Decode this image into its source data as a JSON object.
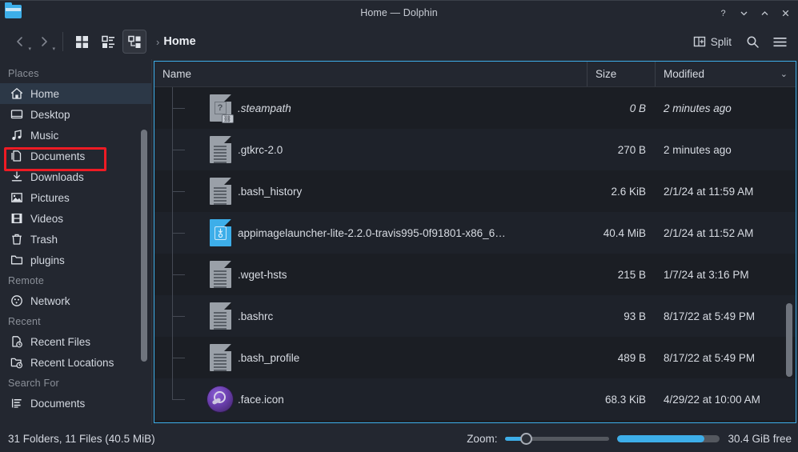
{
  "window": {
    "title": "Home — Dolphin",
    "icon": "folder-icon",
    "buttons": [
      {
        "name": "help-button",
        "glyph": "?"
      },
      {
        "name": "minimize-button",
        "glyph": "chevron-down"
      },
      {
        "name": "maximize-button",
        "glyph": "chevron-up"
      },
      {
        "name": "close-button",
        "glyph": "close"
      }
    ]
  },
  "toolbar": {
    "back_label": "back-icon",
    "forward_label": "forward-icon",
    "view_modes": [
      {
        "name": "view-mode-icons",
        "label": "Icons",
        "active": false
      },
      {
        "name": "view-mode-compact",
        "label": "Compact",
        "active": false
      },
      {
        "name": "view-mode-details",
        "label": "Details",
        "active": true
      }
    ],
    "breadcrumb_arrow": "›",
    "breadcrumb": "Home",
    "split_label": "Split",
    "search_label": "search-icon",
    "menu_label": "hamburger-menu-icon"
  },
  "sidebar": {
    "sections": [
      {
        "header": "Places",
        "items": [
          {
            "label": "Home",
            "icon": "home-icon",
            "selected": true
          },
          {
            "label": "Desktop",
            "icon": "desktop-icon",
            "selected": false
          },
          {
            "label": "Music",
            "icon": "music-icon",
            "selected": false
          },
          {
            "label": "Documents",
            "icon": "documents-icon",
            "selected": false
          },
          {
            "label": "Downloads",
            "icon": "downloads-icon",
            "selected": false
          },
          {
            "label": "Pictures",
            "icon": "pictures-icon",
            "selected": false
          },
          {
            "label": "Videos",
            "icon": "videos-icon",
            "selected": false
          },
          {
            "label": "Trash",
            "icon": "trash-icon",
            "selected": false
          },
          {
            "label": "plugins",
            "icon": "folder-icon",
            "selected": false
          }
        ]
      },
      {
        "header": "Remote",
        "items": [
          {
            "label": "Network",
            "icon": "network-icon",
            "selected": false
          }
        ]
      },
      {
        "header": "Recent",
        "items": [
          {
            "label": "Recent Files",
            "icon": "recent-files-icon",
            "selected": false
          },
          {
            "label": "Recent Locations",
            "icon": "recent-locations-icon",
            "selected": false
          }
        ]
      },
      {
        "header": "Search For",
        "items": [
          {
            "label": "Documents",
            "icon": "search-documents-icon",
            "selected": false
          }
        ]
      }
    ]
  },
  "file_list": {
    "columns": [
      {
        "label": "Name",
        "name": "column-header-name"
      },
      {
        "label": "Size",
        "name": "column-header-size"
      },
      {
        "label": "Modified",
        "name": "column-header-modified",
        "sorted": true
      }
    ],
    "rows": [
      {
        "name": ".steampath",
        "size": "0 B",
        "modified": "2 minutes ago",
        "icon": "symlink-unknown-icon",
        "symlink": true
      },
      {
        "name": ".gtkrc-2.0",
        "size": "270 B",
        "modified": "2 minutes ago",
        "icon": "text-file-icon",
        "symlink": false
      },
      {
        "name": ".bash_history",
        "size": "2.6 KiB",
        "modified": "2/1/24 at 11:59 AM",
        "icon": "text-file-icon",
        "symlink": false
      },
      {
        "name": "appimagelauncher-lite-2.2.0-travis995-0f91801-x86_6…",
        "size": "40.4 MiB",
        "modified": "2/1/24 at 11:52 AM",
        "icon": "appimage-icon",
        "symlink": false
      },
      {
        "name": ".wget-hsts",
        "size": "215 B",
        "modified": "1/7/24 at 3:16 PM",
        "icon": "text-file-icon",
        "symlink": false
      },
      {
        "name": ".bashrc",
        "size": "93 B",
        "modified": "8/17/22 at 5:49 PM",
        "icon": "text-file-icon",
        "symlink": false
      },
      {
        "name": ".bash_profile",
        "size": "489 B",
        "modified": "8/17/22 at 5:49 PM",
        "icon": "text-file-icon",
        "symlink": false
      },
      {
        "name": ".face.icon",
        "size": "68.3 KiB",
        "modified": "4/29/22 at 10:00 AM",
        "icon": "steam-avatar-icon",
        "symlink": false
      }
    ]
  },
  "statusbar": {
    "summary": "31 Folders, 11 Files (40.5 MiB)",
    "zoom_label": "Zoom:",
    "zoom_percent": 20,
    "capacity_percent": 85,
    "free_space": "30.4 GiB free"
  },
  "colors": {
    "accent": "#3daee9",
    "annotation": "#ee1b24",
    "window_bg": "#232730",
    "view_bg": "#1b1e24",
    "selection": "#2c3847"
  }
}
